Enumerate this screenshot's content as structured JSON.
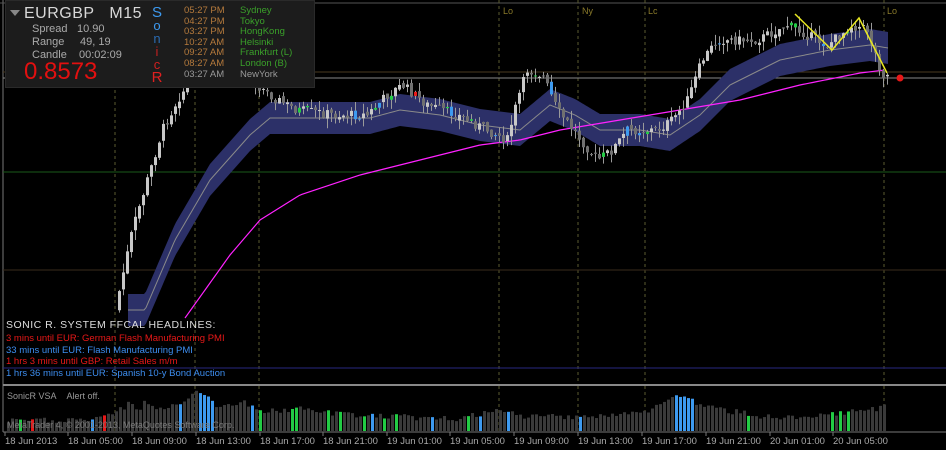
{
  "info": {
    "symbol": "EURGBP",
    "timeframe": "M15",
    "spread_label": "Spread",
    "spread": "10.90",
    "range_label": "Range",
    "range": "49, 19",
    "candle_label": "Candle",
    "candle": "00:02:09",
    "price": "0.8573"
  },
  "sonic_letters": [
    "S",
    "o",
    "n",
    "i",
    "c",
    "R"
  ],
  "sessions": [
    {
      "time": "05:27 PM",
      "city": "Sydney"
    },
    {
      "time": "04:27 PM",
      "city": "Tokyo"
    },
    {
      "time": "03:27 PM",
      "city": "HongKong"
    },
    {
      "time": "10:27 AM",
      "city": "Helsinki"
    },
    {
      "time": "09:27 AM",
      "city": "Frankfurt  (L)"
    },
    {
      "time": "08:27 AM",
      "city": "London  (B)"
    },
    {
      "time": "03:27 AM",
      "city": "NewYork"
    }
  ],
  "session_markers": [
    "Lo",
    "Ny",
    "Lc",
    "Lo"
  ],
  "headlines": {
    "title": "SONIC R. SYSTEM  FFCAL HEADLINES:",
    "items": [
      {
        "text": "3 mins until EUR: German Flash Manufacturing PMI",
        "color": "#e81818"
      },
      {
        "text": "33 mins until EUR: Flash Manufacturing PMI",
        "color": "#3d8ef0"
      },
      {
        "text": "1 hrs 3 mins until GBP: Retail Sales m/m",
        "color": "#e81818"
      },
      {
        "text": "1 hrs 36 mins until EUR: Spanish 10-y Bond Auction",
        "color": "#3d8ef0"
      }
    ]
  },
  "vsa": {
    "label": "SonicR VSA",
    "alert": "Alert off."
  },
  "copyright": "MetaTrader 4, © 2001-2013, MetaQuotes Software Corp.",
  "time_axis": [
    "18 Jun 2013",
    "18 Jun 05:00",
    "18 Jun 09:00",
    "18 Jun 13:00",
    "18 Jun 17:00",
    "18 Jun 21:00",
    "19 Jun 01:00",
    "19 Jun 05:00",
    "19 Jun 09:00",
    "19 Jun 13:00",
    "19 Jun 17:00",
    "19 Jun 21:00",
    "20 Jun 01:00",
    "20 Jun 05:00"
  ],
  "colors": {
    "band": "#2c3068",
    "ma": "#ff22ff",
    "zigzag": "#e8e820",
    "bull": "#22cc44",
    "bear": "#e81818",
    "vol": "#3d9af0"
  }
}
